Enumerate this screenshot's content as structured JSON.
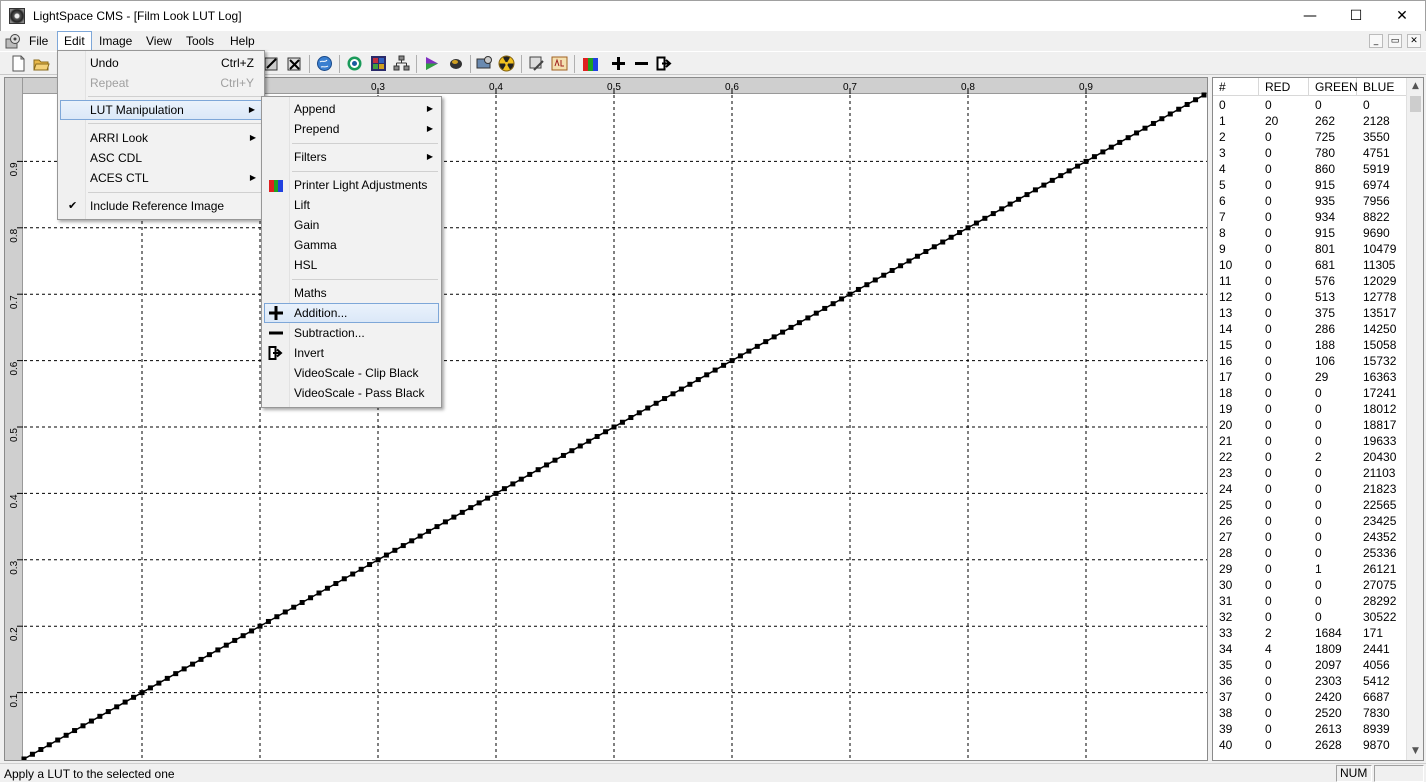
{
  "window": {
    "title": "LightSpace CMS - [Film Look LUT Log]",
    "minimize_glyph": "—",
    "maximize_glyph": "☐",
    "close_glyph": "✕"
  },
  "menubar": {
    "items": [
      "File",
      "Edit",
      "Image",
      "View",
      "Tools",
      "Help"
    ],
    "active": "Edit",
    "mdi_glyphs": [
      "_",
      "▭",
      "✕"
    ]
  },
  "edit_menu": {
    "items": [
      {
        "label": "Undo",
        "shortcut": "Ctrl+Z"
      },
      {
        "label": "Repeat",
        "shortcut": "Ctrl+Y",
        "disabled": true
      },
      {
        "label": "LUT Manipulation",
        "submenu": true,
        "highlighted": true
      },
      {
        "label": "ARRI Look",
        "submenu": true
      },
      {
        "label": "ASC CDL"
      },
      {
        "label": "ACES CTL",
        "submenu": true
      },
      {
        "label": "Include Reference Image",
        "checked": true
      }
    ]
  },
  "lut_menu": {
    "items": [
      {
        "label": "Append",
        "submenu": true
      },
      {
        "label": "Prepend",
        "submenu": true
      },
      {
        "label": "Filters",
        "submenu": true
      },
      {
        "label": "Printer Light Adjustments",
        "icon": "rgb-bars-icon"
      },
      {
        "label": "Lift"
      },
      {
        "label": "Gain"
      },
      {
        "label": "Gamma"
      },
      {
        "label": "HSL"
      },
      {
        "label": "Maths"
      },
      {
        "label": "Addition...",
        "icon": "plus-icon",
        "highlighted": true
      },
      {
        "label": "Subtraction...",
        "icon": "minus-icon"
      },
      {
        "label": "Invert",
        "icon": "invert-icon"
      },
      {
        "label": "VideoScale - Clip Black"
      },
      {
        "label": "VideoScale - Pass Black"
      }
    ]
  },
  "plot": {
    "x_ticks": [
      "0.3",
      "0.4",
      "0.5",
      "0.6",
      "0.7",
      "0.8",
      "0.9"
    ],
    "y_ticks": [
      "0.9",
      "0.8",
      "0.7",
      "0.6",
      "0.5",
      "0.4",
      "0.3",
      "0.2",
      "0.1"
    ]
  },
  "chart_data": {
    "type": "line",
    "x_tick_labels": [
      "0.3",
      "0.4",
      "0.5",
      "0.6",
      "0.7",
      "0.8",
      "0.9"
    ],
    "y_tick_labels": [
      "0.1",
      "0.2",
      "0.3",
      "0.4",
      "0.5",
      "0.6",
      "0.7",
      "0.8",
      "0.9"
    ],
    "xlim": [
      0,
      1
    ],
    "ylim": [
      0,
      1
    ],
    "grid": true,
    "series": [
      {
        "x": [
          0,
          1
        ],
        "y": [
          0,
          1
        ]
      }
    ]
  },
  "table": {
    "headers": [
      "#",
      "RED",
      "GREEN",
      "BLUE"
    ],
    "rows": [
      [
        "0",
        "0",
        "0",
        "0"
      ],
      [
        "1",
        "20",
        "262",
        "2128"
      ],
      [
        "2",
        "0",
        "725",
        "3550"
      ],
      [
        "3",
        "0",
        "780",
        "4751"
      ],
      [
        "4",
        "0",
        "860",
        "5919"
      ],
      [
        "5",
        "0",
        "915",
        "6974"
      ],
      [
        "6",
        "0",
        "935",
        "7956"
      ],
      [
        "7",
        "0",
        "934",
        "8822"
      ],
      [
        "8",
        "0",
        "915",
        "9690"
      ],
      [
        "9",
        "0",
        "801",
        "10479"
      ],
      [
        "10",
        "0",
        "681",
        "11305"
      ],
      [
        "11",
        "0",
        "576",
        "12029"
      ],
      [
        "12",
        "0",
        "513",
        "12778"
      ],
      [
        "13",
        "0",
        "375",
        "13517"
      ],
      [
        "14",
        "0",
        "286",
        "14250"
      ],
      [
        "15",
        "0",
        "188",
        "15058"
      ],
      [
        "16",
        "0",
        "106",
        "15732"
      ],
      [
        "17",
        "0",
        "29",
        "16363"
      ],
      [
        "18",
        "0",
        "0",
        "17241"
      ],
      [
        "19",
        "0",
        "0",
        "18012"
      ],
      [
        "20",
        "0",
        "0",
        "18817"
      ],
      [
        "21",
        "0",
        "0",
        "19633"
      ],
      [
        "22",
        "0",
        "2",
        "20430"
      ],
      [
        "23",
        "0",
        "0",
        "21103"
      ],
      [
        "24",
        "0",
        "0",
        "21823"
      ],
      [
        "25",
        "0",
        "0",
        "22565"
      ],
      [
        "26",
        "0",
        "0",
        "23425"
      ],
      [
        "27",
        "0",
        "0",
        "24352"
      ],
      [
        "28",
        "0",
        "0",
        "25336"
      ],
      [
        "29",
        "0",
        "1",
        "26121"
      ],
      [
        "30",
        "0",
        "0",
        "27075"
      ],
      [
        "31",
        "0",
        "0",
        "28292"
      ],
      [
        "32",
        "0",
        "0",
        "30522"
      ],
      [
        "33",
        "2",
        "1684",
        "171"
      ],
      [
        "34",
        "4",
        "1809",
        "2441"
      ],
      [
        "35",
        "0",
        "2097",
        "4056"
      ],
      [
        "36",
        "0",
        "2303",
        "5412"
      ],
      [
        "37",
        "0",
        "2420",
        "6687"
      ],
      [
        "38",
        "0",
        "2520",
        "7830"
      ],
      [
        "39",
        "0",
        "2613",
        "8939"
      ],
      [
        "40",
        "0",
        "2628",
        "9870"
      ]
    ],
    "scroll_up": "▲",
    "scroll_down": "▼"
  },
  "status": {
    "text": "Apply a LUT to the selected one",
    "num": "NUM"
  },
  "colors": {
    "menu_highlight_border": "#7ea7d8",
    "grid_line": "#000000",
    "curve": "#000000"
  }
}
